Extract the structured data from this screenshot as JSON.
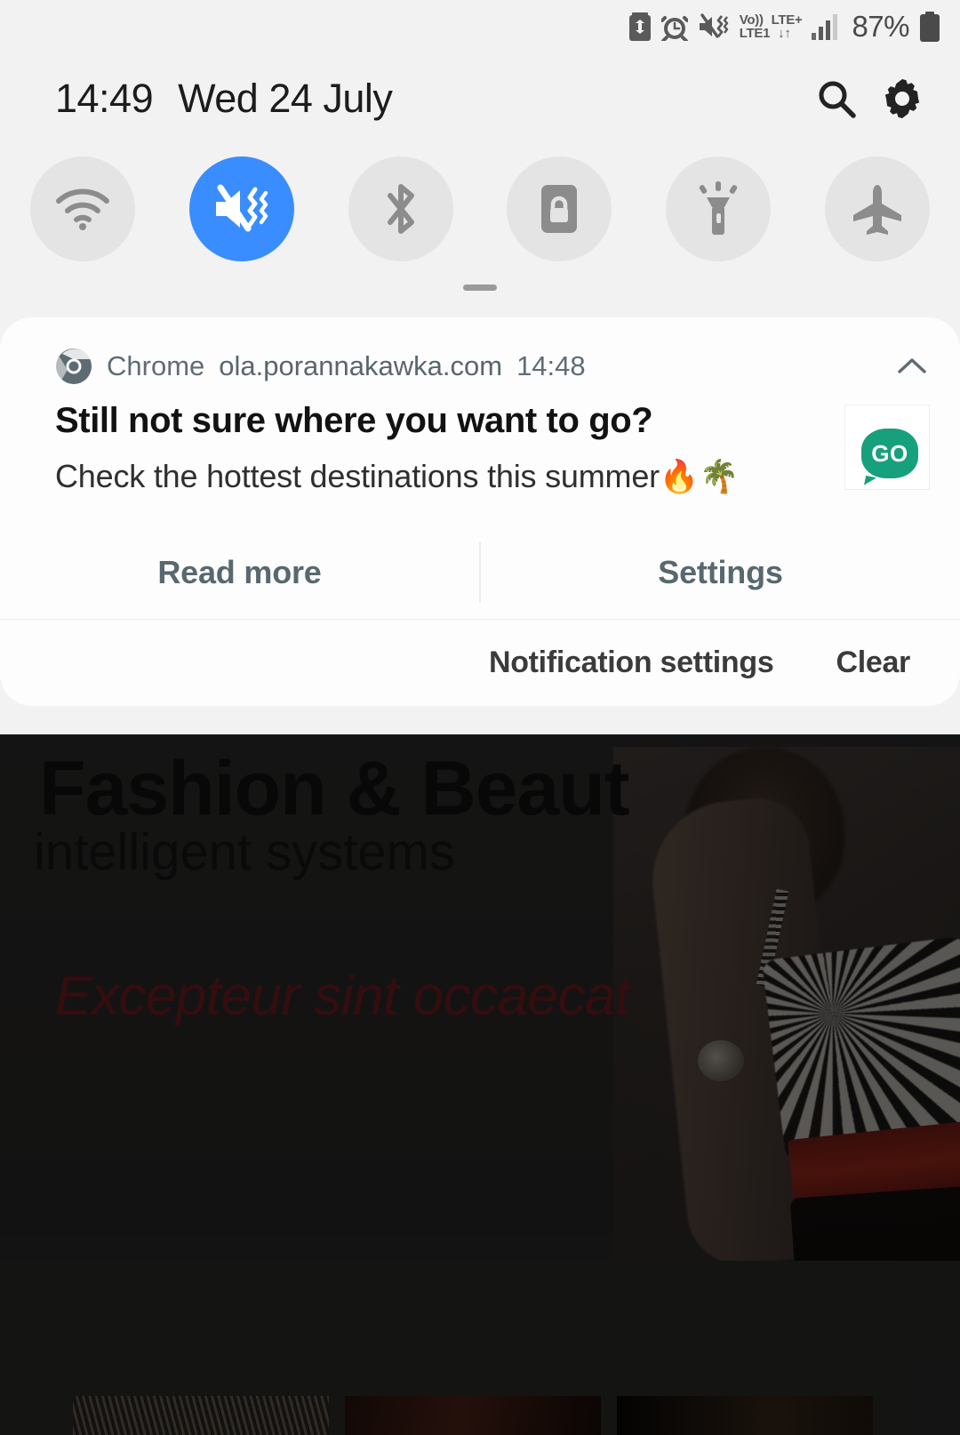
{
  "status_bar": {
    "icons": [
      "battery-saver-icon",
      "alarm-icon",
      "mute-vibrate-icon",
      "volte-icon",
      "signal-bars-icon"
    ],
    "network_lines": {
      "line1_left": "Vo))",
      "line1_right": "LTE+",
      "line2_left": "LTE1",
      "line2_right": "↓↑"
    },
    "battery_percent": "87%"
  },
  "quick_settings": {
    "clock": "14:49",
    "date": "Wed 24 July",
    "search_icon": "search-icon",
    "settings_icon": "gear-icon",
    "toggles": [
      {
        "name": "wifi",
        "icon": "wifi-icon",
        "active": false
      },
      {
        "name": "sound",
        "icon": "mute-vibrate-icon",
        "active": true
      },
      {
        "name": "bluetooth",
        "icon": "bluetooth-icon",
        "active": false
      },
      {
        "name": "rotation",
        "icon": "rotation-lock-icon",
        "active": false
      },
      {
        "name": "flashlight",
        "icon": "flashlight-icon",
        "active": false
      },
      {
        "name": "airplane",
        "icon": "airplane-icon",
        "active": false
      }
    ],
    "drag_handle": "drag-handle"
  },
  "notification": {
    "app_name": "Chrome",
    "app_icon": "chrome-logo-icon",
    "source_url": "ola.porannakawka.com",
    "time": "14:48",
    "collapse_icon": "chevron-up-icon",
    "title": "Still not sure where you want to go?",
    "body": "Check the hottest destinations this summer🔥🌴",
    "thumbnail_label": "GO",
    "thumbnail_color": "#17a07c",
    "actions": [
      {
        "label": "Read more"
      },
      {
        "label": "Settings"
      }
    ]
  },
  "shade_footer": {
    "notification_settings_label": "Notification settings",
    "clear_label": "Clear"
  },
  "background_page": {
    "heading": "Fashion & Beaut",
    "subheading": "intelligent systems",
    "quote": "Excepteur sint occaecat",
    "thumbnails": [
      "thumb-1",
      "thumb-2",
      "thumb-3"
    ]
  },
  "colors": {
    "accent_blue": "#3a8dfe",
    "shade_bg": "#f2f2f2",
    "card_bg": "#fdfdfd",
    "action_text": "#58686f",
    "quote_red": "#7a1f22"
  }
}
